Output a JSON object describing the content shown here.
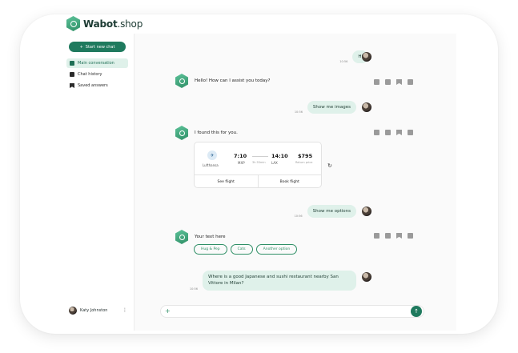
{
  "brand": {
    "name": "Wabot",
    "suffix": ".shop"
  },
  "sidebar": {
    "new_chat_label": "Start new chat",
    "items": [
      {
        "label": "Main conversation",
        "icon": "chat-icon",
        "active": true
      },
      {
        "label": "Chat history",
        "icon": "history-icon",
        "active": false
      },
      {
        "label": "Saved answers",
        "icon": "bookmark-icon",
        "active": false
      }
    ],
    "user_name": "Katy Johnston",
    "menu_glyph": "⋮"
  },
  "chat": {
    "messages": [
      {
        "from": "user",
        "text": "Hi",
        "time": "10:56"
      },
      {
        "from": "bot",
        "text": "Hello! How can I assist you today?"
      },
      {
        "from": "user",
        "text": "Show me images",
        "time": "10:56"
      },
      {
        "from": "bot",
        "text": "I found this for you."
      },
      {
        "from": "user",
        "text": "Show me options",
        "time": "10:56"
      },
      {
        "from": "bot",
        "text": "Your text here"
      },
      {
        "from": "user",
        "text": "Where is a good Japanese and sushi restaurant nearby San Vittore in Milan?",
        "time": "10:56"
      }
    ],
    "flight_card": {
      "airline": "Lufthansa",
      "depart_time": "7:10",
      "depart_code": "MXP",
      "duration": "3h 55min",
      "arrive_time": "14:10",
      "arrive_code": "LAX",
      "price": "$795",
      "price_note": "Return price",
      "see_label": "See flight",
      "book_label": "Book flight"
    },
    "chips": [
      "Hug & Pep",
      "Cats",
      "Another option"
    ],
    "refresh_glyph": "↻"
  },
  "composer": {
    "placeholder": "",
    "plus_glyph": "+",
    "send_glyph": "↑"
  },
  "colors": {
    "accent": "#1f7a5e",
    "bubble": "#dff1ea",
    "logo_green": "#2f8f66"
  }
}
